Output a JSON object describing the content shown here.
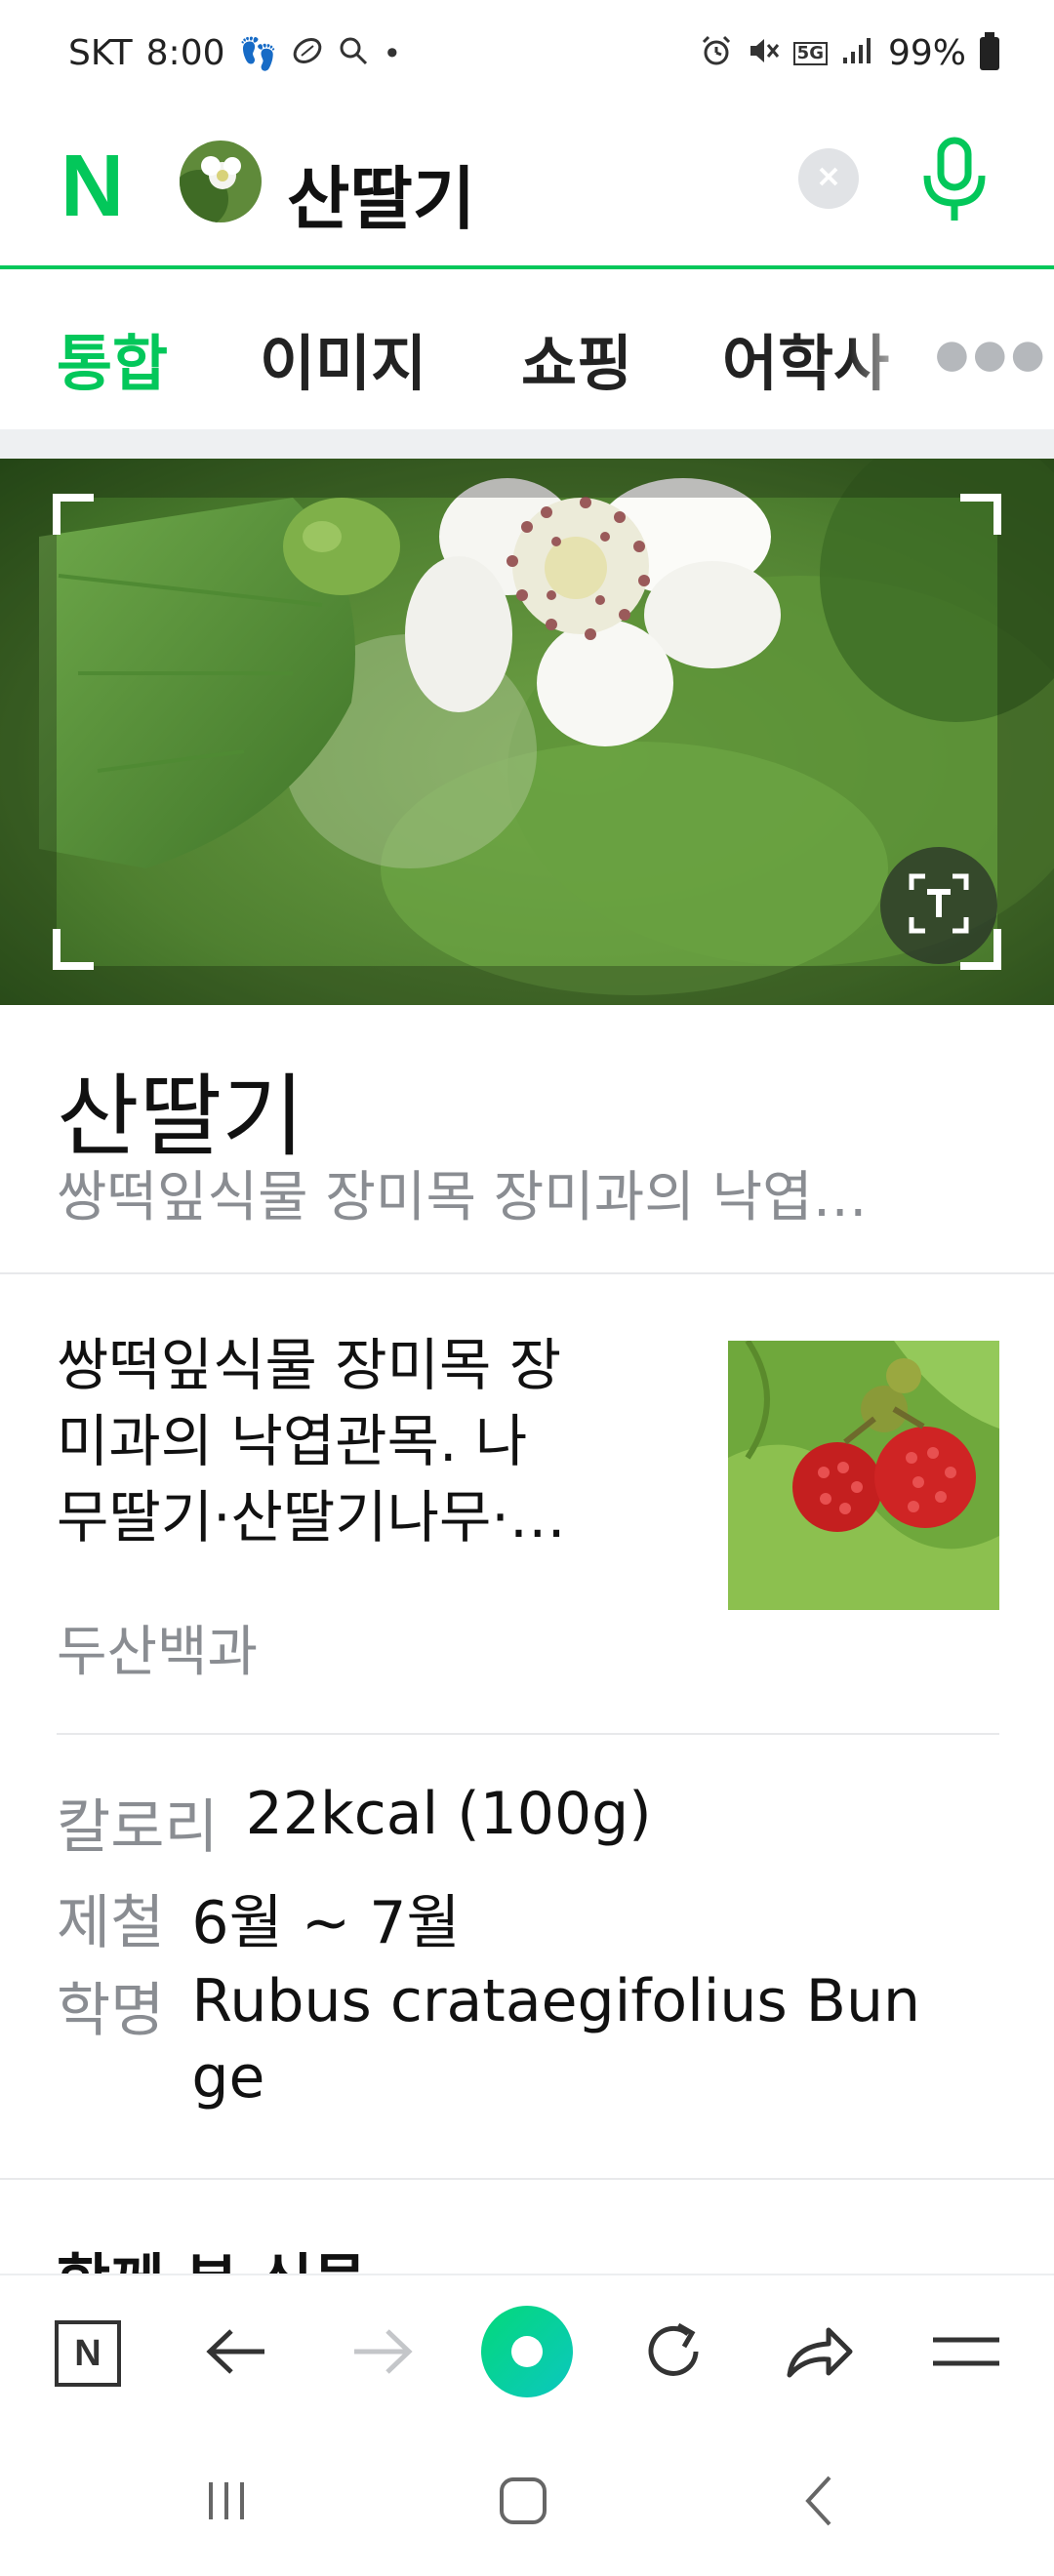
{
  "status_bar": {
    "carrier": "SKT",
    "time": "8:00",
    "battery": "99%",
    "network": "5G"
  },
  "search": {
    "logo": "N",
    "query": "산딸기"
  },
  "tabs": [
    {
      "label": "통합",
      "active": true
    },
    {
      "label": "이미지",
      "active": false
    },
    {
      "label": "쇼핑",
      "active": false
    },
    {
      "label": "어학사",
      "active": false
    }
  ],
  "entity": {
    "title": "산딸기",
    "subtitle": "쌍떡잎식물 장미목 장미과의 낙엽…",
    "description_lines": [
      "쌍떡잎식물 장미목 장",
      "미과의 낙엽관목. 나",
      "무딸기·산딸기나무·…"
    ],
    "source": "두산백과"
  },
  "info": [
    {
      "label": "칼로리",
      "value": "22kcal (100g)"
    },
    {
      "label": "제철",
      "value": "6월 ~ 7월"
    },
    {
      "label": "학명",
      "value_lines": [
        "Rubus crataegifolius Bun",
        "ge"
      ]
    }
  ],
  "next_section": "함께 본 식물",
  "toolbar": {
    "home": "N"
  },
  "colors": {
    "brand": "#03c75a",
    "muted_text": "#8a8d92"
  }
}
